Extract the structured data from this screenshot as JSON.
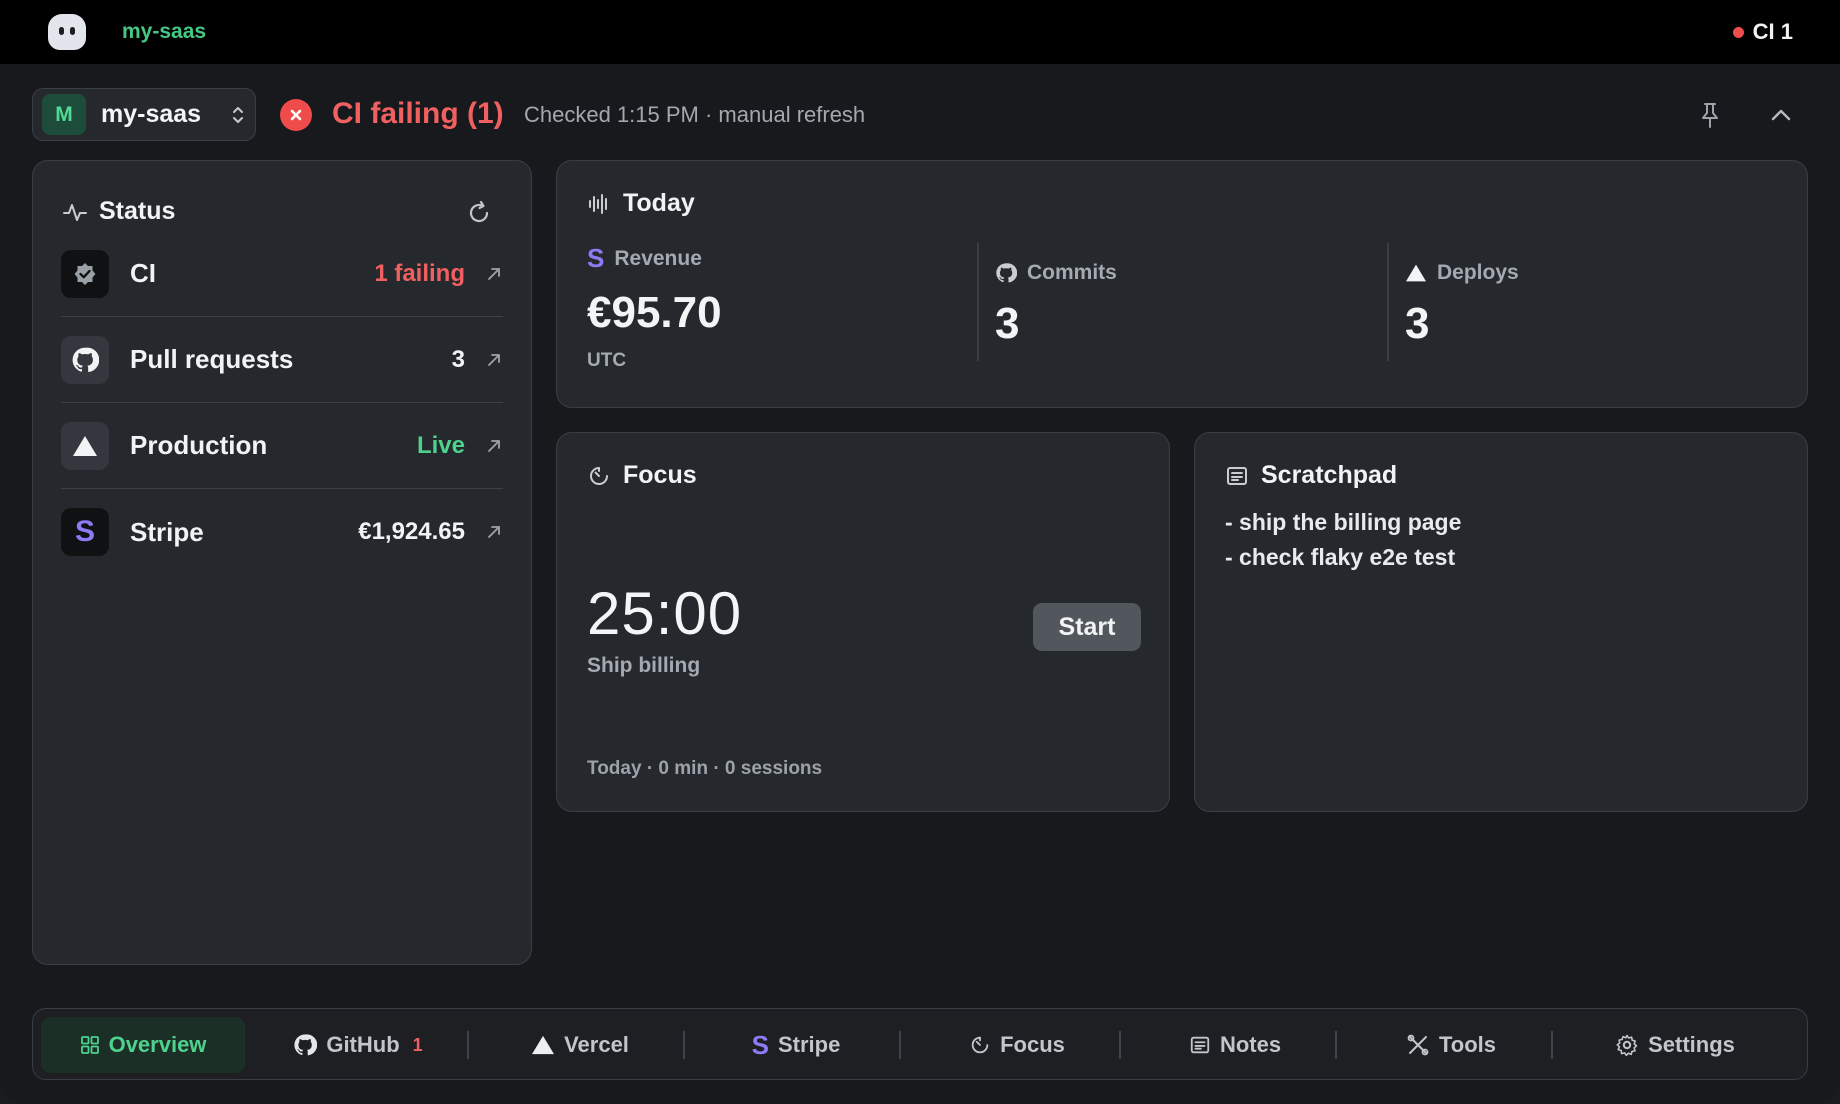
{
  "topbar": {
    "project_name": "my-saas",
    "ci_indicator": "CI 1"
  },
  "header": {
    "project_avatar": "M",
    "project_name": "my-saas",
    "ci_status": "CI failing (1)",
    "checked": "Checked 1:15 PM · manual refresh"
  },
  "status": {
    "title": "Status",
    "rows": [
      {
        "label": "CI",
        "value": "1 failing",
        "value_color": "#f06060",
        "icon": "shield-check-icon"
      },
      {
        "label": "Pull requests",
        "value": "3",
        "value_color": "#f2f3f5",
        "icon": "github-icon"
      },
      {
        "label": "Production",
        "value": "Live",
        "value_color": "#4fd18e",
        "icon": "vercel-triangle-icon"
      },
      {
        "label": "Stripe",
        "value": "€1,924.65",
        "value_color": "#f2f3f5",
        "icon": "stripe-icon"
      }
    ]
  },
  "today": {
    "title": "Today",
    "revenue": {
      "label": "Revenue",
      "value": "€95.70",
      "sub": "UTC"
    },
    "commits": {
      "label": "Commits",
      "value": "3"
    },
    "deploys": {
      "label": "Deploys",
      "value": "3"
    }
  },
  "focus": {
    "title": "Focus",
    "timer": "25:00",
    "task": "Ship billing",
    "start_label": "Start",
    "stats": "Today · 0 min · 0 sessions"
  },
  "scratchpad": {
    "title": "Scratchpad",
    "lines": [
      "- ship the billing page",
      "- check flaky e2e test"
    ]
  },
  "nav": {
    "items": [
      {
        "label": "Overview",
        "icon": "grid-icon"
      },
      {
        "label": "GitHub",
        "badge": "1",
        "icon": "github-icon"
      },
      {
        "label": "Vercel",
        "icon": "vercel-triangle-icon"
      },
      {
        "label": "Stripe",
        "icon": "stripe-icon"
      },
      {
        "label": "Focus",
        "icon": "timer-icon"
      },
      {
        "label": "Notes",
        "icon": "notes-icon"
      },
      {
        "label": "Tools",
        "icon": "tools-icon"
      },
      {
        "label": "Settings",
        "icon": "gear-icon"
      }
    ],
    "active": "Overview"
  },
  "colors": {
    "accent_green": "#4fd18e",
    "error_red": "#f06060",
    "stripe_purple": "#8b7cf6",
    "card_bg": "#25282c"
  }
}
